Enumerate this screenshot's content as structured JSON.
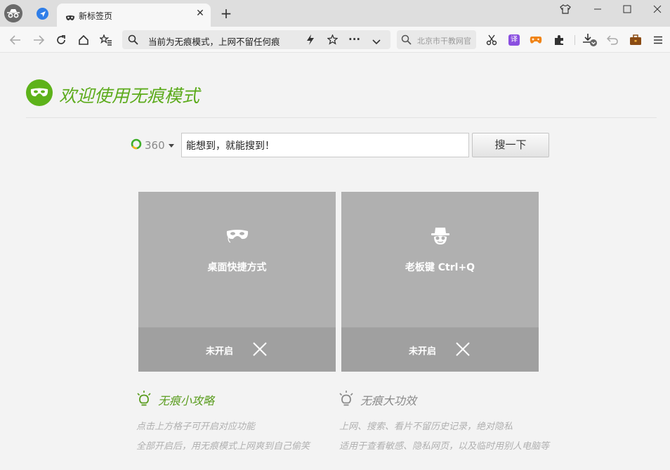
{
  "tab": {
    "title": "新标签页"
  },
  "toolbar": {
    "address_text": "当前为无痕模式，上网不留任何痕",
    "search_placeholder": "北京市干教网官"
  },
  "extensions": {
    "translate_label": "译"
  },
  "page": {
    "welcome": "欢迎使用无痕模式",
    "search": {
      "engine": "360",
      "input_text": "能想到，就能搜到！",
      "button": "搜一下"
    },
    "cards": [
      {
        "title": "桌面快捷方式",
        "status": "未开启",
        "icon": "mask-icon"
      },
      {
        "title": "老板键 Ctrl+Q",
        "status": "未开启",
        "icon": "spy-icon"
      }
    ],
    "tips": [
      {
        "heading": "无痕小攻略",
        "color": "#5a9c1e",
        "lines": [
          "点击上方格子可开启对应功能",
          "全部开启后，用无痕模式上网爽到自己偷笑"
        ]
      },
      {
        "heading": "无痕大功效",
        "color": "#8a8a8a",
        "lines": [
          "上网、搜索、看片不留历史记录，绝对隐私",
          "适用于查看敏感、隐私网页，以及临时用别人电脑等"
        ]
      }
    ]
  },
  "colors": {
    "accent_green": "#5db21a",
    "card_bg": "#b0b0b0",
    "card_footer": "#a0a0a0"
  }
}
